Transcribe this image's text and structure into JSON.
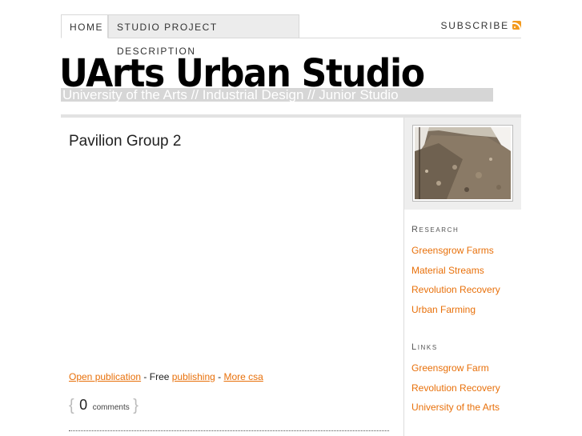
{
  "nav": {
    "tabs": [
      {
        "label": "HOME"
      },
      {
        "label": "STUDIO PROJECT DESCRIPTION"
      }
    ],
    "subscribe_label": "SUBSCRIBE",
    "subscribe_icon": "rss-feed-icon"
  },
  "header": {
    "title": "UArts Urban Studio",
    "tagline": "University of the Arts // Industrial Design // Junior Studio"
  },
  "post": {
    "title": "Pavilion Group 2",
    "links": {
      "open_publication": "Open publication",
      "free_text": " - Free ",
      "publishing": "publishing",
      "sep": " - ",
      "more": "More csa"
    },
    "comment_count": "0",
    "comment_label": "comments"
  },
  "sidebar": {
    "photo_alt": "gravel-ground-photo",
    "sections": [
      {
        "heading": "Research",
        "items": [
          "Greensgrow Farms",
          "Material Streams",
          "Revolution Recovery",
          "Urban Farming"
        ]
      },
      {
        "heading": "Links",
        "items": [
          "Greensgrow Farm",
          "Revolution Recovery",
          "University of the Arts"
        ]
      }
    ]
  },
  "colors": {
    "accent": "#e8700a",
    "rss": "#f39a1d",
    "tagline_bg": "#d6d6d6"
  }
}
